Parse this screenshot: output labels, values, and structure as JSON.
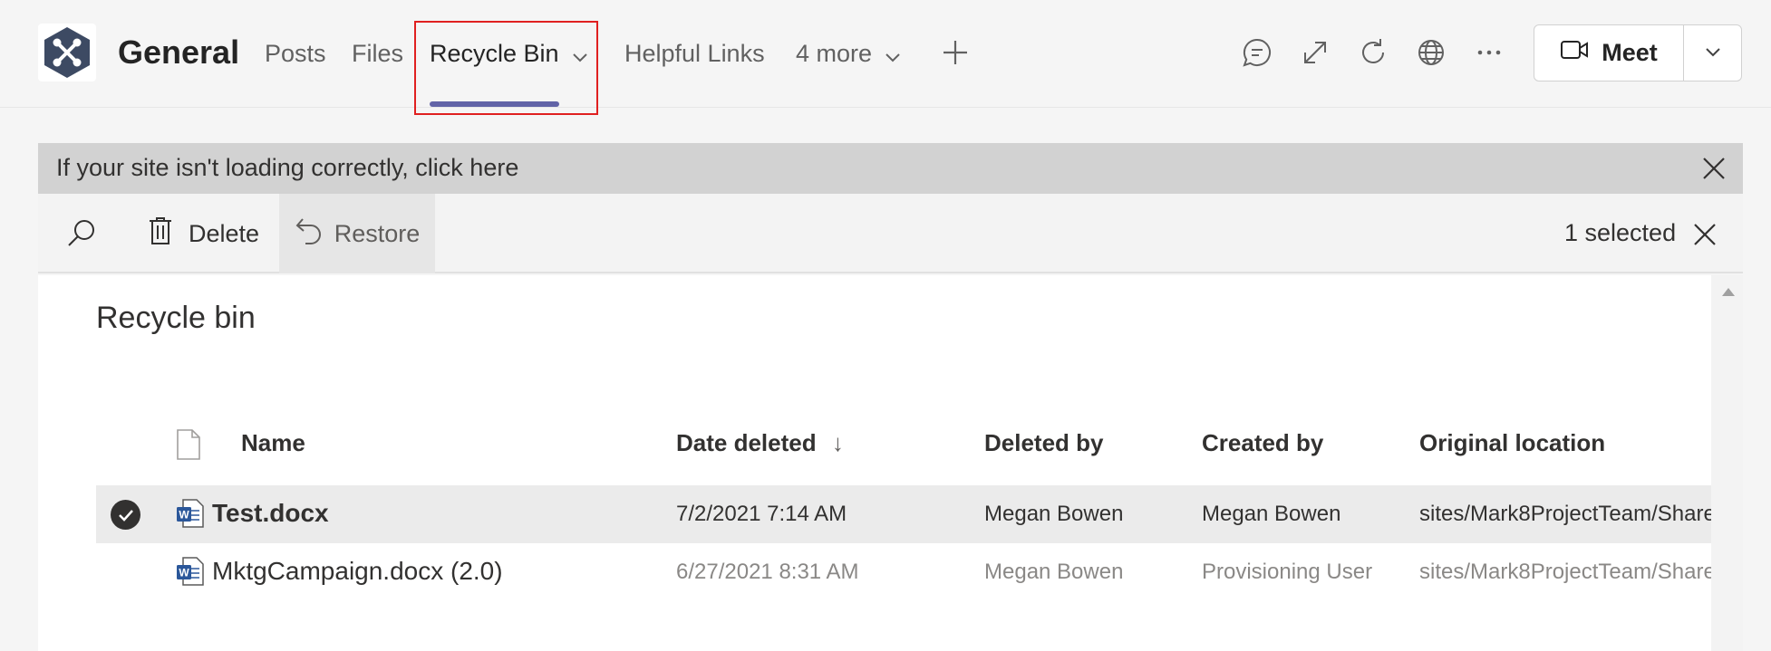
{
  "header": {
    "team_name": "General",
    "tabs": [
      {
        "label": "Posts"
      },
      {
        "label": "Files"
      },
      {
        "label": "Recycle Bin"
      },
      {
        "label": "Helpful Links"
      },
      {
        "label": "4 more"
      }
    ],
    "meet_label": "Meet"
  },
  "notice": {
    "text": "If your site isn't loading correctly, click here"
  },
  "commandbar": {
    "delete_label": "Delete",
    "restore_label": "Restore",
    "selected_text": "1 selected"
  },
  "page": {
    "title": "Recycle bin"
  },
  "table": {
    "columns": [
      "Name",
      "Date deleted",
      "Deleted by",
      "Created by",
      "Original location"
    ],
    "sort_indicator": "↓",
    "rows": [
      {
        "name": "Test.docx",
        "date_deleted": "7/2/2021 7:14 AM",
        "deleted_by": "Megan Bowen",
        "created_by": "Megan Bowen",
        "original_location": "sites/Mark8ProjectTeam/Share",
        "selected": true
      },
      {
        "name": "MktgCampaign.docx (2.0)",
        "date_deleted": "6/27/2021 8:31 AM",
        "deleted_by": "Megan Bowen",
        "created_by": "Provisioning User",
        "original_location": "sites/Mark8ProjectTeam/Share",
        "selected": false
      }
    ]
  },
  "colors": {
    "accent": "#6264a7",
    "highlight_box": "#e02020",
    "word_blue": "#2b579a"
  }
}
